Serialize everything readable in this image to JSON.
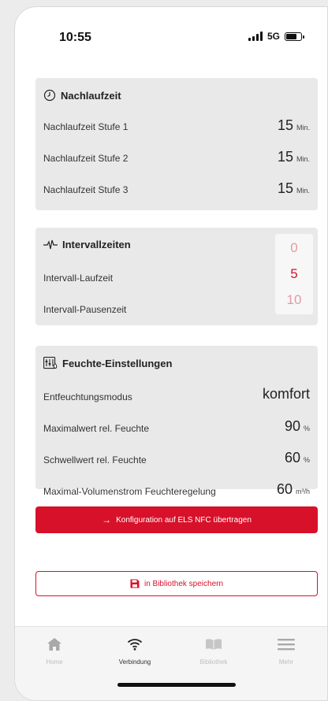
{
  "status": {
    "time": "10:55",
    "network": "5G"
  },
  "nachlaufzeit": {
    "title": "Nachlaufzeit",
    "icon": "clock-icon",
    "rows": [
      {
        "label": "Nachlaufzeit Stufe 1",
        "value": "15",
        "unit": "Min."
      },
      {
        "label": "Nachlaufzeit Stufe 2",
        "value": "15",
        "unit": "Min."
      },
      {
        "label": "Nachlaufzeit Stufe 3",
        "value": "15",
        "unit": "Min."
      }
    ]
  },
  "intervall": {
    "title": "Intervallzeiten",
    "icon": "pulse-icon",
    "rows": [
      {
        "label": "Intervall-Laufzeit"
      },
      {
        "label": "Intervall-Pausenzeit"
      }
    ],
    "picker": [
      "0",
      "5",
      "10"
    ]
  },
  "feuchte": {
    "title": "Feuchte-Einstellungen",
    "icon": "humidity-settings-icon",
    "rows": [
      {
        "label": "Entfeuchtungsmodus",
        "value": "komfort",
        "unit": ""
      },
      {
        "label": "Maximalwert rel. Feuchte",
        "value": "90",
        "unit": "%"
      },
      {
        "label": "Schwellwert rel. Feuchte",
        "value": "60",
        "unit": "%"
      },
      {
        "label": "Maximal-Volumenstrom Feuchteregelung",
        "value": "60",
        "unit": "m³/h"
      }
    ]
  },
  "actions": {
    "transfer_label": "Konfiguration auf ELS NFC übertragen",
    "save_label": "in Bibliothek speichern"
  },
  "tabs": [
    {
      "label": "Home",
      "icon": "home-icon"
    },
    {
      "label": "Verbindung",
      "icon": "wifi-icon"
    },
    {
      "label": "Bibliothek",
      "icon": "book-icon"
    },
    {
      "label": "Mehr",
      "icon": "menu-icon"
    }
  ],
  "colors": {
    "accent": "#d8112a",
    "card": "#e9e9e9"
  }
}
